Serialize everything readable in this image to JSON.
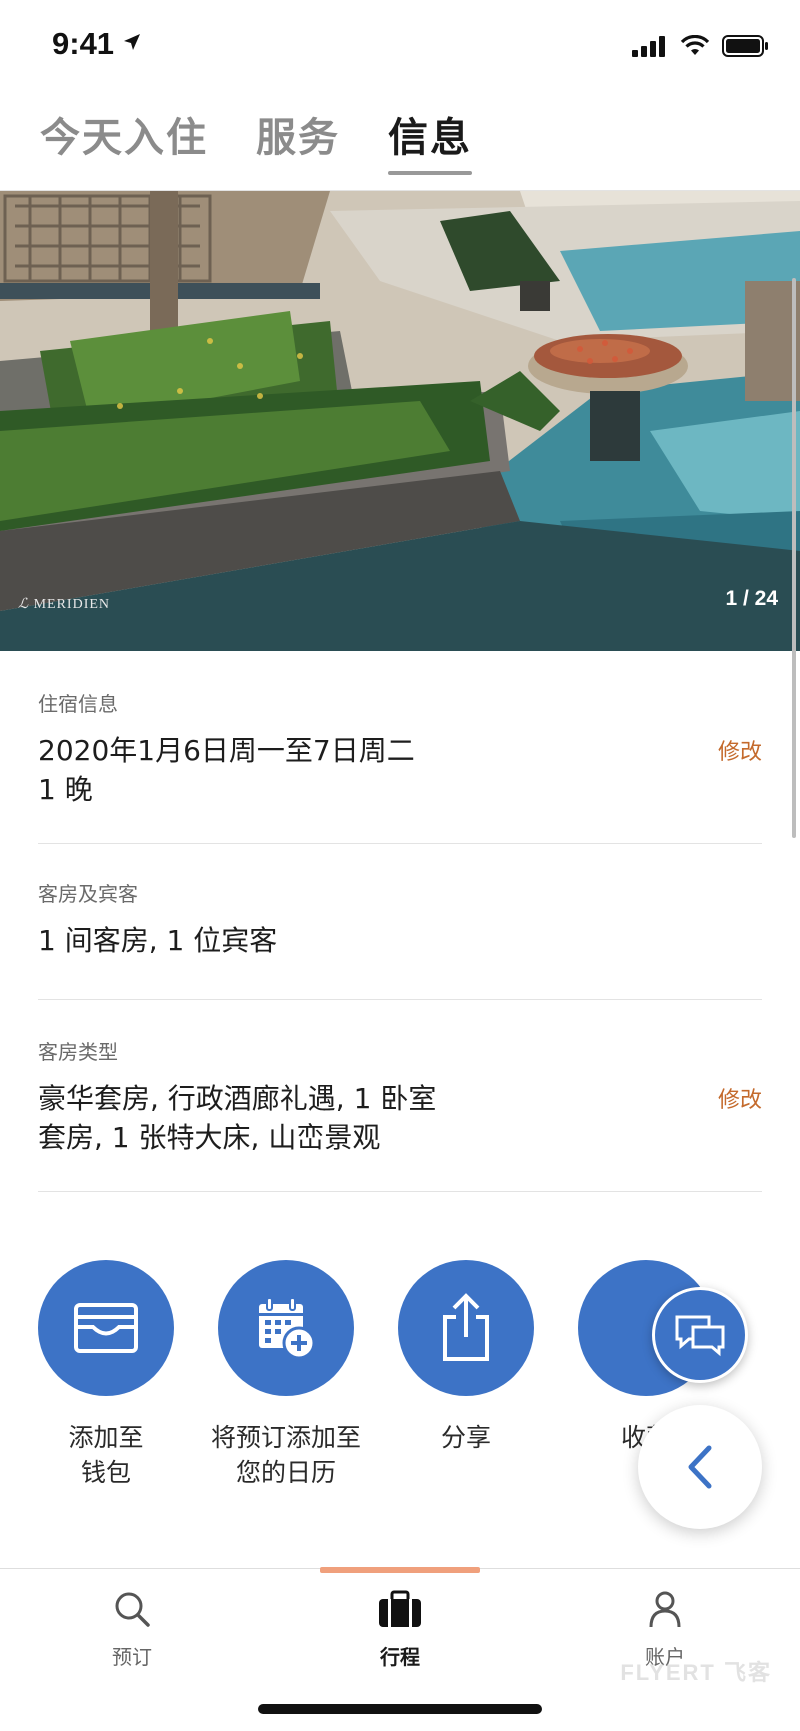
{
  "status_bar": {
    "time": "9:41"
  },
  "tabs": [
    {
      "label": "今天入住"
    },
    {
      "label": "服务"
    },
    {
      "label": "信息"
    }
  ],
  "hero": {
    "brand": "MERIDIEN",
    "counter": "1 / 24"
  },
  "stay": {
    "label": "住宿信息",
    "dates": "2020年1月6日周一至7日周二",
    "nights": "1 晚",
    "edit": "修改"
  },
  "rooms_guests": {
    "label": "客房及宾客",
    "value": "1 间客房, 1 位宾客"
  },
  "room_type": {
    "label": "客房类型",
    "line1": "豪华套房, 行政酒廊礼遇, 1 卧室",
    "line2": "套房, 1  张特大床, 山峦景观",
    "edit": "修改"
  },
  "actions": [
    {
      "line1": "添加至",
      "line2": "钱包",
      "icon": "wallet-icon"
    },
    {
      "line1": "将预订添加至",
      "line2": "您的日历",
      "icon": "calendar-add-icon"
    },
    {
      "line1": "分享",
      "line2": "",
      "icon": "share-icon"
    },
    {
      "line1": "收藏",
      "line2": "",
      "icon": "favorite-icon"
    }
  ],
  "bottom_nav": [
    {
      "label": "预订",
      "icon": "search-icon"
    },
    {
      "label": "行程",
      "icon": "briefcase-icon"
    },
    {
      "label": "账户",
      "icon": "person-icon"
    }
  ],
  "watermark": "FLYERT 飞客",
  "colors": {
    "accent": "#3d73c6",
    "edit": "#c46a2c",
    "nav_indicator": "#f0a07c"
  }
}
